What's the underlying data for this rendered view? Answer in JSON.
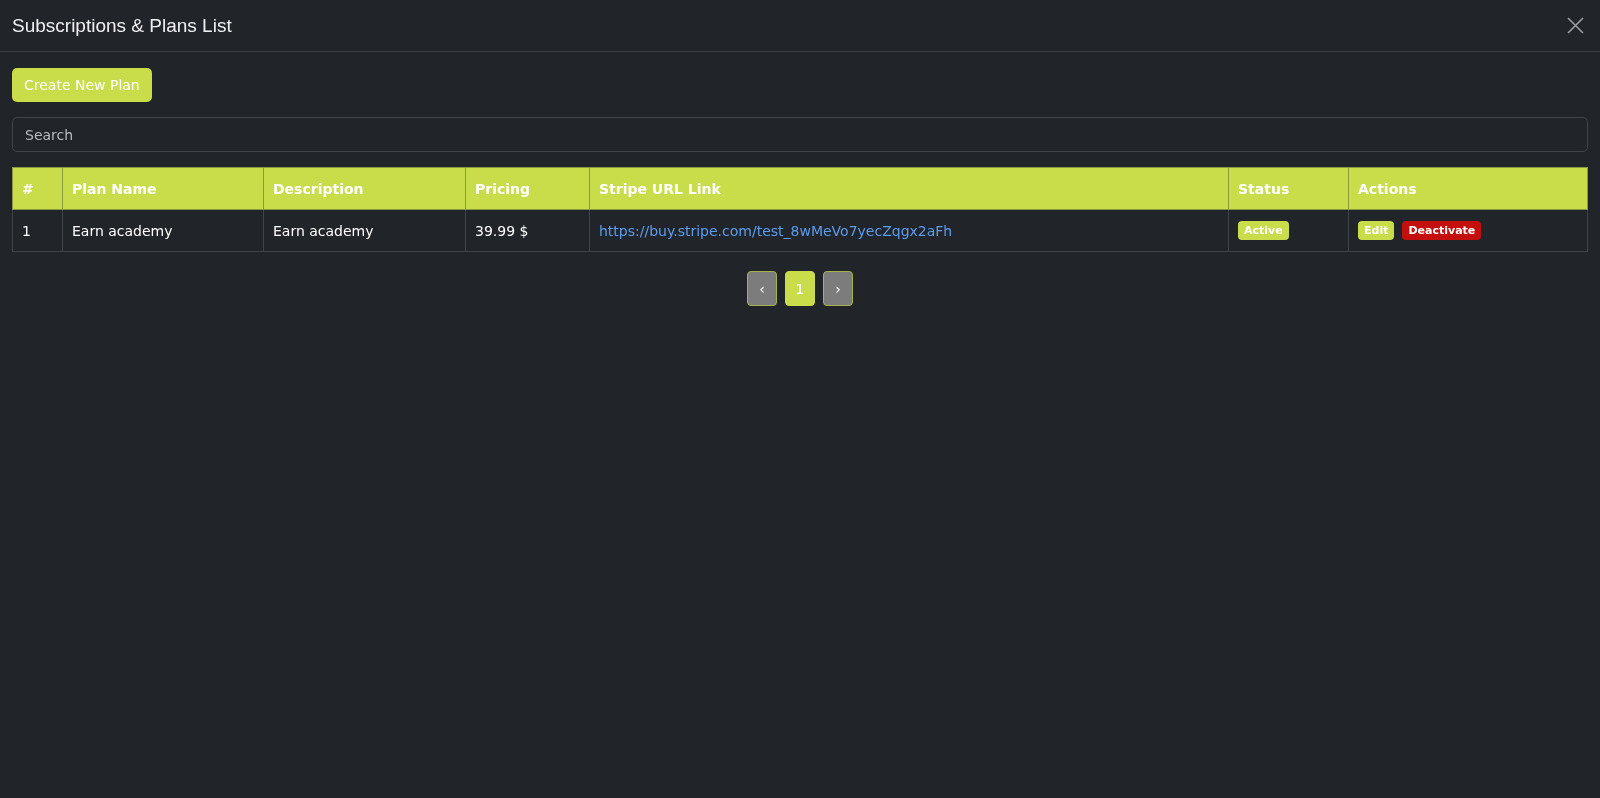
{
  "window": {
    "title": "Subscriptions & Plans List"
  },
  "create_button": "Create New Plan",
  "search": {
    "placeholder": "Search"
  },
  "table": {
    "columns": [
      "#",
      "Plan Name",
      "Description",
      "Pricing",
      "Stripe URL Link",
      "Status",
      "Actions"
    ],
    "rows": [
      {
        "number": "1",
        "plan_name": "Earn academy",
        "description": "Earn academy",
        "pricing": "39.99 $",
        "stripe_url": "https://buy.stripe.com/test_8wMeVo7yecZqgx2aFh",
        "status": "Active",
        "actions": [
          {
            "label": "Edit",
            "kind": "edit"
          },
          {
            "label": "Deactivate",
            "kind": "deactivate"
          }
        ]
      }
    ]
  },
  "pagination": {
    "prev": "‹",
    "next": "›",
    "pages": [
      {
        "label": "1",
        "selected": true
      }
    ]
  }
}
